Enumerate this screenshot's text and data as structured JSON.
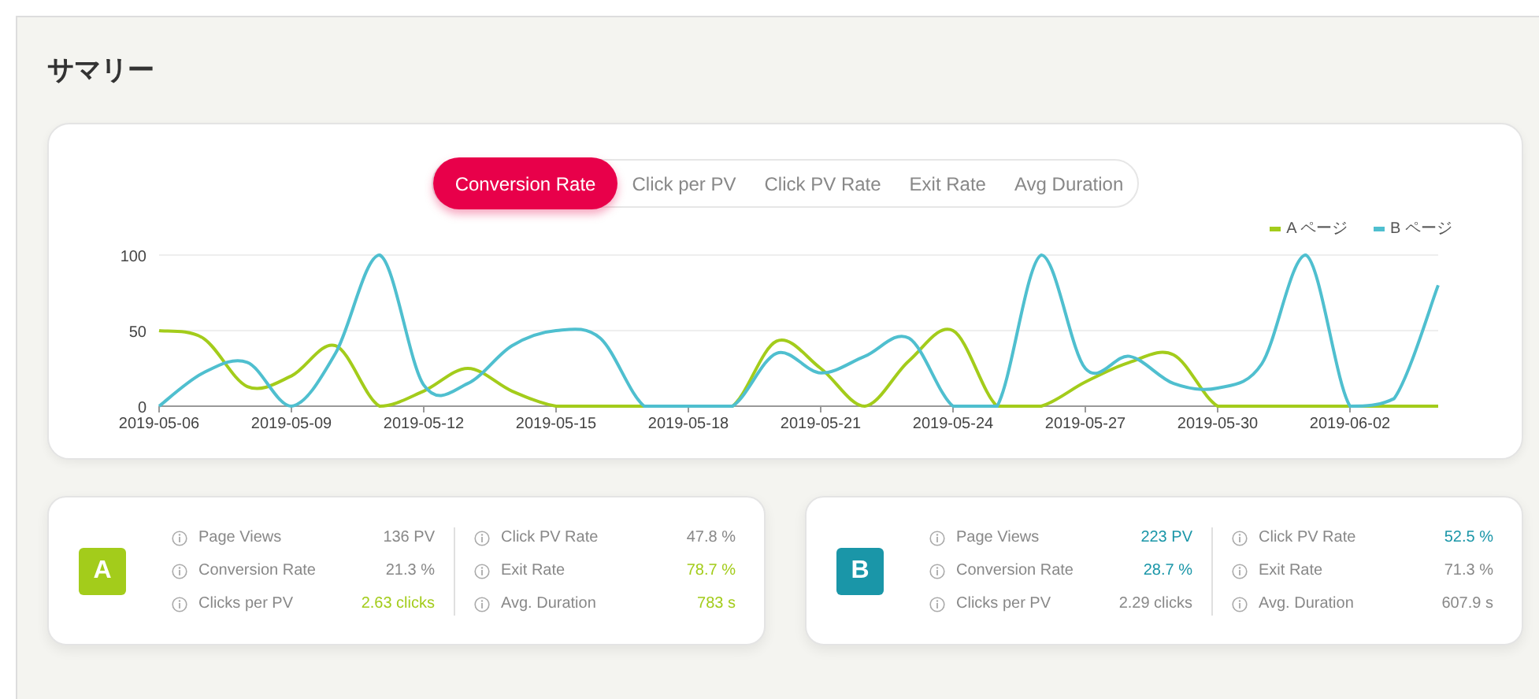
{
  "title": "サマリー",
  "tabs": [
    {
      "label": "Conversion Rate",
      "selected": true
    },
    {
      "label": "Click per PV",
      "selected": false
    },
    {
      "label": "Click PV Rate",
      "selected": false
    },
    {
      "label": "Exit Rate",
      "selected": false
    },
    {
      "label": "Avg Duration",
      "selected": false
    }
  ],
  "chart_data": {
    "type": "line",
    "x": [
      "2019-05-06",
      "2019-05-07",
      "2019-05-08",
      "2019-05-09",
      "2019-05-10",
      "2019-05-11",
      "2019-05-12",
      "2019-05-13",
      "2019-05-14",
      "2019-05-15",
      "2019-05-16",
      "2019-05-17",
      "2019-05-18",
      "2019-05-19",
      "2019-05-20",
      "2019-05-21",
      "2019-05-22",
      "2019-05-23",
      "2019-05-24",
      "2019-05-25",
      "2019-05-26",
      "2019-05-27",
      "2019-05-28",
      "2019-05-29",
      "2019-05-30",
      "2019-05-31",
      "2019-06-01",
      "2019-06-02",
      "2019-06-03",
      "2019-06-04"
    ],
    "series": [
      {
        "name": "A ページ",
        "color": "#a3cc1b",
        "values": [
          50,
          45,
          13,
          20,
          40,
          0,
          10,
          25,
          10,
          0,
          0,
          0,
          0,
          0,
          43,
          25,
          0,
          30,
          50,
          0,
          0,
          16,
          29,
          34,
          0,
          0,
          0,
          0,
          0,
          0
        ]
      },
      {
        "name": "B ページ",
        "color": "#4fbfcf",
        "values": [
          0,
          22,
          29,
          0,
          35,
          100,
          14,
          15,
          40,
          50,
          45,
          0,
          0,
          0,
          35,
          22,
          33,
          45,
          0,
          0,
          100,
          25,
          33,
          15,
          12,
          28,
          100,
          0,
          5,
          80
        ]
      }
    ],
    "xticks": [
      {
        "value": "2019-05-06",
        "label": "2019-05-06"
      },
      {
        "value": "2019-05-09",
        "label": "2019-05-09"
      },
      {
        "value": "2019-05-12",
        "label": "2019-05-12"
      },
      {
        "value": "2019-05-15",
        "label": "2019-05-15"
      },
      {
        "value": "2019-05-18",
        "label": "2019-05-18"
      },
      {
        "value": "2019-05-21",
        "label": "2019-05-21"
      },
      {
        "value": "2019-05-24",
        "label": "2019-05-24"
      },
      {
        "value": "2019-05-27",
        "label": "2019-05-27"
      },
      {
        "value": "2019-05-30",
        "label": "2019-05-30"
      },
      {
        "value": "2019-06-02",
        "label": "2019-06-02"
      }
    ],
    "xlim": [
      "2019-05-06",
      "2019-06-04"
    ],
    "yticks": [
      0,
      50,
      100
    ],
    "ylim": [
      0,
      100
    ]
  },
  "cards": [
    {
      "badge": "A",
      "color": "#a3cc1b",
      "columns": [
        [
          {
            "label": "Page Views",
            "value": "136 PV",
            "highlighted": false
          },
          {
            "label": "Conversion Rate",
            "value": "21.3 %",
            "highlighted": false
          },
          {
            "label": "Clicks per PV",
            "value": "2.63 clicks",
            "highlighted": true
          }
        ],
        [
          {
            "label": "Click PV Rate",
            "value": "47.8 %",
            "highlighted": false
          },
          {
            "label": "Exit Rate",
            "value": "78.7 %",
            "highlighted": true
          },
          {
            "label": "Avg. Duration",
            "value": "783 s",
            "highlighted": true
          }
        ]
      ]
    },
    {
      "badge": "B",
      "color": "#1a96a8",
      "columns": [
        [
          {
            "label": "Page Views",
            "value": "223 PV",
            "highlighted": true
          },
          {
            "label": "Conversion Rate",
            "value": "28.7 %",
            "highlighted": true
          },
          {
            "label": "Clicks per PV",
            "value": "2.29 clicks",
            "highlighted": false
          }
        ],
        [
          {
            "label": "Click PV Rate",
            "value": "52.5 %",
            "highlighted": true
          },
          {
            "label": "Exit Rate",
            "value": "71.3 %",
            "highlighted": false
          },
          {
            "label": "Avg. Duration",
            "value": "607.9 s",
            "highlighted": false
          }
        ]
      ]
    }
  ]
}
